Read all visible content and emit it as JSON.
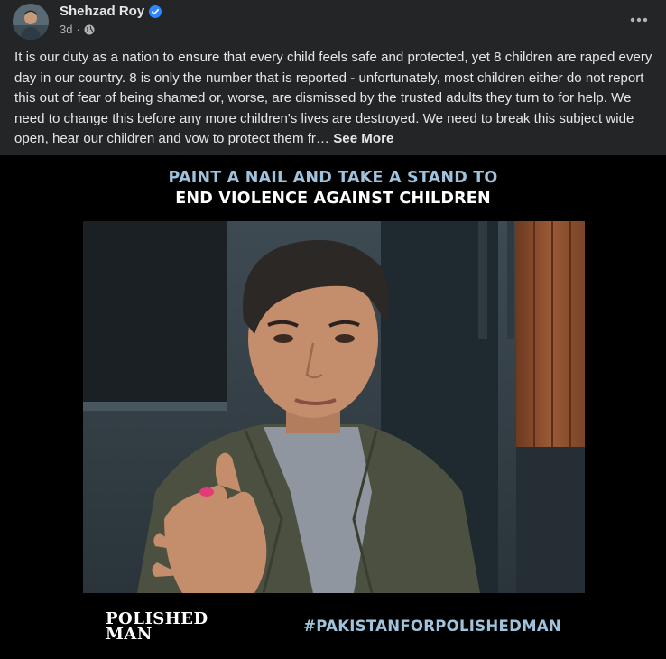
{
  "post": {
    "author": "Shehzad Roy",
    "time": "3d",
    "visibility_icon": "globe-icon",
    "verified_icon": "verified-badge-icon",
    "more_icon": "more-options-icon",
    "text": "It is our duty as a nation to ensure that every child feels safe and protected, yet 8 children are raped every day in our country. 8 is only the number that is reported - unfortunately, most children either do not report this out of fear of being shamed or, worse, are dismissed by the trusted adults they turn to for help. We need to change this before any more children's lives are destroyed. We need to break this subject wide open, hear our children and vow to protect them fr…",
    "see_more": "See More"
  },
  "media": {
    "headline_line1": "PAINT A NAIL AND TAKE A STAND TO",
    "headline_line2": "END VIOLENCE AGAINST CHILDREN",
    "logo_line1": "POLISHED",
    "logo_line2": "MAN",
    "hashtag": "#PAKISTANFORPOLISHEDMAN"
  },
  "colors": {
    "background": "#242526",
    "text": "#e4e6eb",
    "secondary_text": "#b0b3b8",
    "verified_blue": "#2d88ff",
    "headline_blue": "#9fc3dc",
    "media_background": "#000000"
  }
}
